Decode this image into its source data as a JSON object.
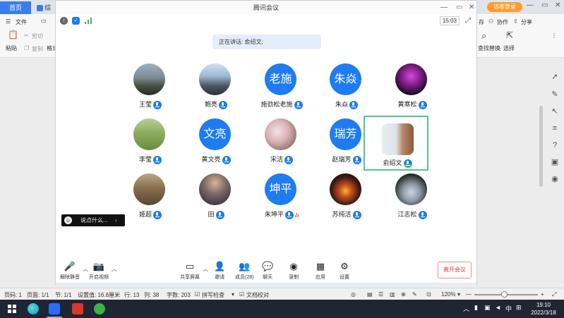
{
  "wps": {
    "tabs": {
      "home": "首页",
      "doc": "综合"
    },
    "login": "访客登录",
    "ribbon": {
      "file": "文件",
      "paste": "粘贴",
      "cut": "剪切",
      "copy": "复制",
      "format": "格式",
      "save": "存",
      "collab": "协作",
      "share": "分享",
      "find_replace": "查找替换",
      "select": "选择"
    },
    "status": {
      "page": "页码: 1",
      "pages": "页面: 1/1",
      "section": "节: 1/1",
      "setting": "设置值: 16.8厘米",
      "row": "行: 13",
      "col": "列: 38",
      "words": "字数: 203",
      "spellcheck": "拼写检查",
      "proofread": "文档校对",
      "zoom": "120%"
    }
  },
  "meeting": {
    "title": "腾讯会议",
    "time": "15:03",
    "speaking": "正在讲话: 俞绍文;",
    "participants": [
      {
        "name": "王莹",
        "avatar_text": ""
      },
      {
        "name": "鲍亮",
        "avatar_text": ""
      },
      {
        "name": "施劲松老施",
        "avatar_text": "老施"
      },
      {
        "name": "朱焱",
        "avatar_text": "朱焱"
      },
      {
        "name": "黄寒松",
        "avatar_text": ""
      },
      {
        "name": "李莹",
        "avatar_text": ""
      },
      {
        "name": "黄文亮",
        "avatar_text": "文亮"
      },
      {
        "name": "宋洁",
        "avatar_text": ""
      },
      {
        "name": "赵瑞芳",
        "avatar_text": "瑞芳"
      },
      {
        "name": "俞绍文",
        "avatar_text": ""
      },
      {
        "name": "姬超",
        "avatar_text": ""
      },
      {
        "name": "田",
        "avatar_text": ""
      },
      {
        "name": "朱坤平",
        "avatar_text": "坤平"
      },
      {
        "name": "苏纯洁",
        "avatar_text": ""
      },
      {
        "name": "江志松",
        "avatar_text": ""
      }
    ],
    "chat_placeholder": "说点什么...",
    "toolbar": {
      "unmute": "解除静音",
      "start_video": "开启视频",
      "share_screen": "共享屏幕",
      "invite": "邀请",
      "members": "成员(28)",
      "chat": "聊天",
      "record": "录制",
      "apps": "应用",
      "settings": "设置",
      "leave": "离开会议"
    }
  },
  "taskbar": {
    "ime": "中",
    "time": "19:10",
    "date": "2022/3/18"
  }
}
